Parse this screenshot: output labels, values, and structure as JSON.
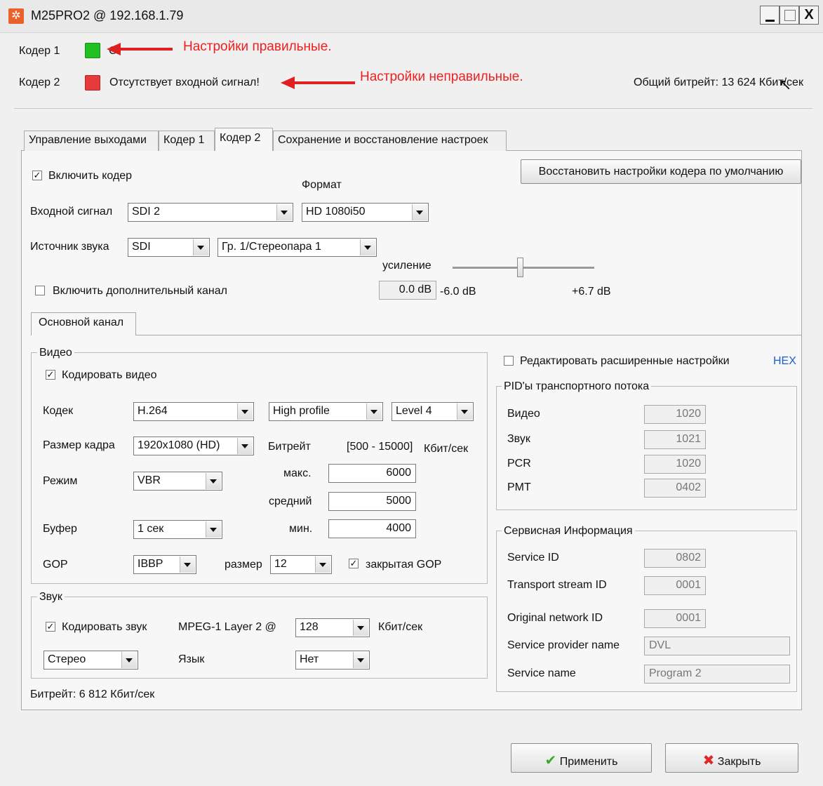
{
  "window": {
    "title": "M25PRO2 @ 192.168.1.79",
    "close_glyph": "X"
  },
  "status": {
    "coder1_label": "Кодер 1",
    "coder1_status": "C",
    "coder2_label": "Кодер 2",
    "coder2_status": "Отсутствует входной сигнал!",
    "total_bitrate": "Общий битрейт: 13 624 Кбит/сек",
    "ok_color": "#22c022",
    "error_color": "#e53b3b"
  },
  "annotations": {
    "correct": "Настройки правильные.",
    "incorrect": "Настройки неправильные."
  },
  "tabs": [
    "Управление выходами",
    "Кодер 1",
    "Кодер 2",
    "Сохранение и восстановление настроек"
  ],
  "encoder": {
    "enable_label": "Включить кодер",
    "enable_checked": true,
    "restore_button": "Восстановить настройки кодера по умолчанию",
    "format_label": "Формат",
    "input_label": "Входной сигнал",
    "input_value": "SDI 2",
    "format_value": "HD 1080i50",
    "audio_source_label": "Источник звука",
    "audio_source_value": "SDI",
    "audio_group_value": "Гр. 1/Стереопара 1",
    "gain_label": "усиление",
    "gain_value": "0.0 dB",
    "gain_min": "-6.0 dB",
    "gain_max": "+6.7 dB",
    "extra_channel_label": "Включить дополнительный канал",
    "extra_channel_checked": false,
    "subtab": "Основной канал"
  },
  "video": {
    "legend": "Видео",
    "encode_label": "Кодировать видео",
    "encode_checked": true,
    "codec_label": "Кодек",
    "codec_value": "H.264",
    "profile_value": "High profile",
    "level_value": "Level 4",
    "frame_label": "Размер кадра",
    "frame_value": "1920x1080 (HD)",
    "bitrate_label": "Битрейт",
    "bitrate_range": "[500 - 15000]",
    "bitrate_unit": "Кбит/сек",
    "mode_label": "Режим",
    "mode_value": "VBR",
    "max_label": "макс.",
    "max_value": "6000",
    "avg_label": "средний",
    "avg_value": "5000",
    "buffer_label": "Буфер",
    "buffer_value": "1 сек",
    "min_label": "мин.",
    "min_value": "4000",
    "gop_label": "GOP",
    "gop_value": "IBBP",
    "size_label": "размер",
    "size_value": "12",
    "closed_gop_label": "закрытая GOP",
    "closed_gop_checked": true
  },
  "audio": {
    "legend": "Звук",
    "encode_label": "Кодировать звук",
    "encode_checked": true,
    "codec_text": "MPEG-1 Layer 2 @",
    "bitrate_value": "128",
    "bitrate_unit": "Кбит/сек",
    "mode_value": "Стерео",
    "lang_label": "Язык",
    "lang_value": "Нет"
  },
  "bitrate_footer": "Битрейт: 6 812 Кбит/сек",
  "advanced": {
    "edit_label": "Редактировать расширенные настройки",
    "edit_checked": false,
    "hex_link": "HEX"
  },
  "pids": {
    "legend": "PID'ы транспортного потока",
    "video_label": "Видео",
    "video_value": "1020",
    "audio_label": "Звук",
    "audio_value": "1021",
    "pcr_label": "PCR",
    "pcr_value": "1020",
    "pmt_label": "PMT",
    "pmt_value": "0402"
  },
  "service": {
    "legend": "Сервисная Информация",
    "service_id_label": "Service ID",
    "service_id_value": "0802",
    "ts_id_label": "Transport stream ID",
    "ts_id_value": "0001",
    "onid_label": "Original network ID",
    "onid_value": "0001",
    "provider_label": "Service provider name",
    "provider_value": "DVL",
    "name_label": "Service name",
    "name_value": "Program 2"
  },
  "footer": {
    "apply": "Применить",
    "close": "Закрыть"
  }
}
